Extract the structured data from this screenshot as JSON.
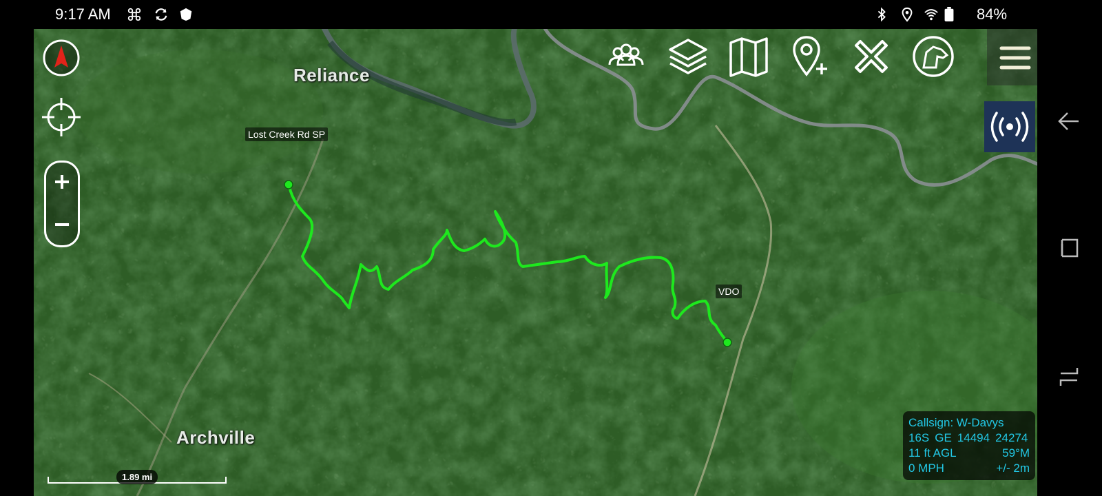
{
  "status_bar": {
    "time": "9:17 AM",
    "battery": "84%",
    "left_icons": [
      "drone-icon",
      "sync-icon",
      "shield-icon"
    ],
    "right_icons": [
      "bluetooth-icon",
      "location-icon",
      "wifi-icon",
      "battery-icon"
    ]
  },
  "map": {
    "places": {
      "reliance": "Reliance",
      "archville": "Archville"
    },
    "waypoints": {
      "start": "Lost Creek Rd SP",
      "end": "VDO"
    },
    "scale": "1.89 mi",
    "track_color": "#1ee81e"
  },
  "toolbar": [
    "contacts-icon",
    "layers-icon",
    "map-icon",
    "add-point-icon",
    "tools-icon",
    "k9-icon",
    "menu-icon"
  ],
  "controls": [
    "compass-icon",
    "locate-icon",
    "zoom-in-button",
    "zoom-out-button",
    "radio-icon"
  ],
  "info_panel": {
    "callsign": "Callsign: W-Davys",
    "grid_zone": "16S",
    "grid_square": "GE",
    "easting": "14494",
    "northing": "24274",
    "altitude": "11 ft AGL",
    "heading": "59°M",
    "speed": "0 MPH",
    "accuracy": "+/- 2m"
  },
  "colors": {
    "info_text": "#22c8e6",
    "track": "#1ee81e",
    "radio_button_bg": "#1e3357"
  }
}
